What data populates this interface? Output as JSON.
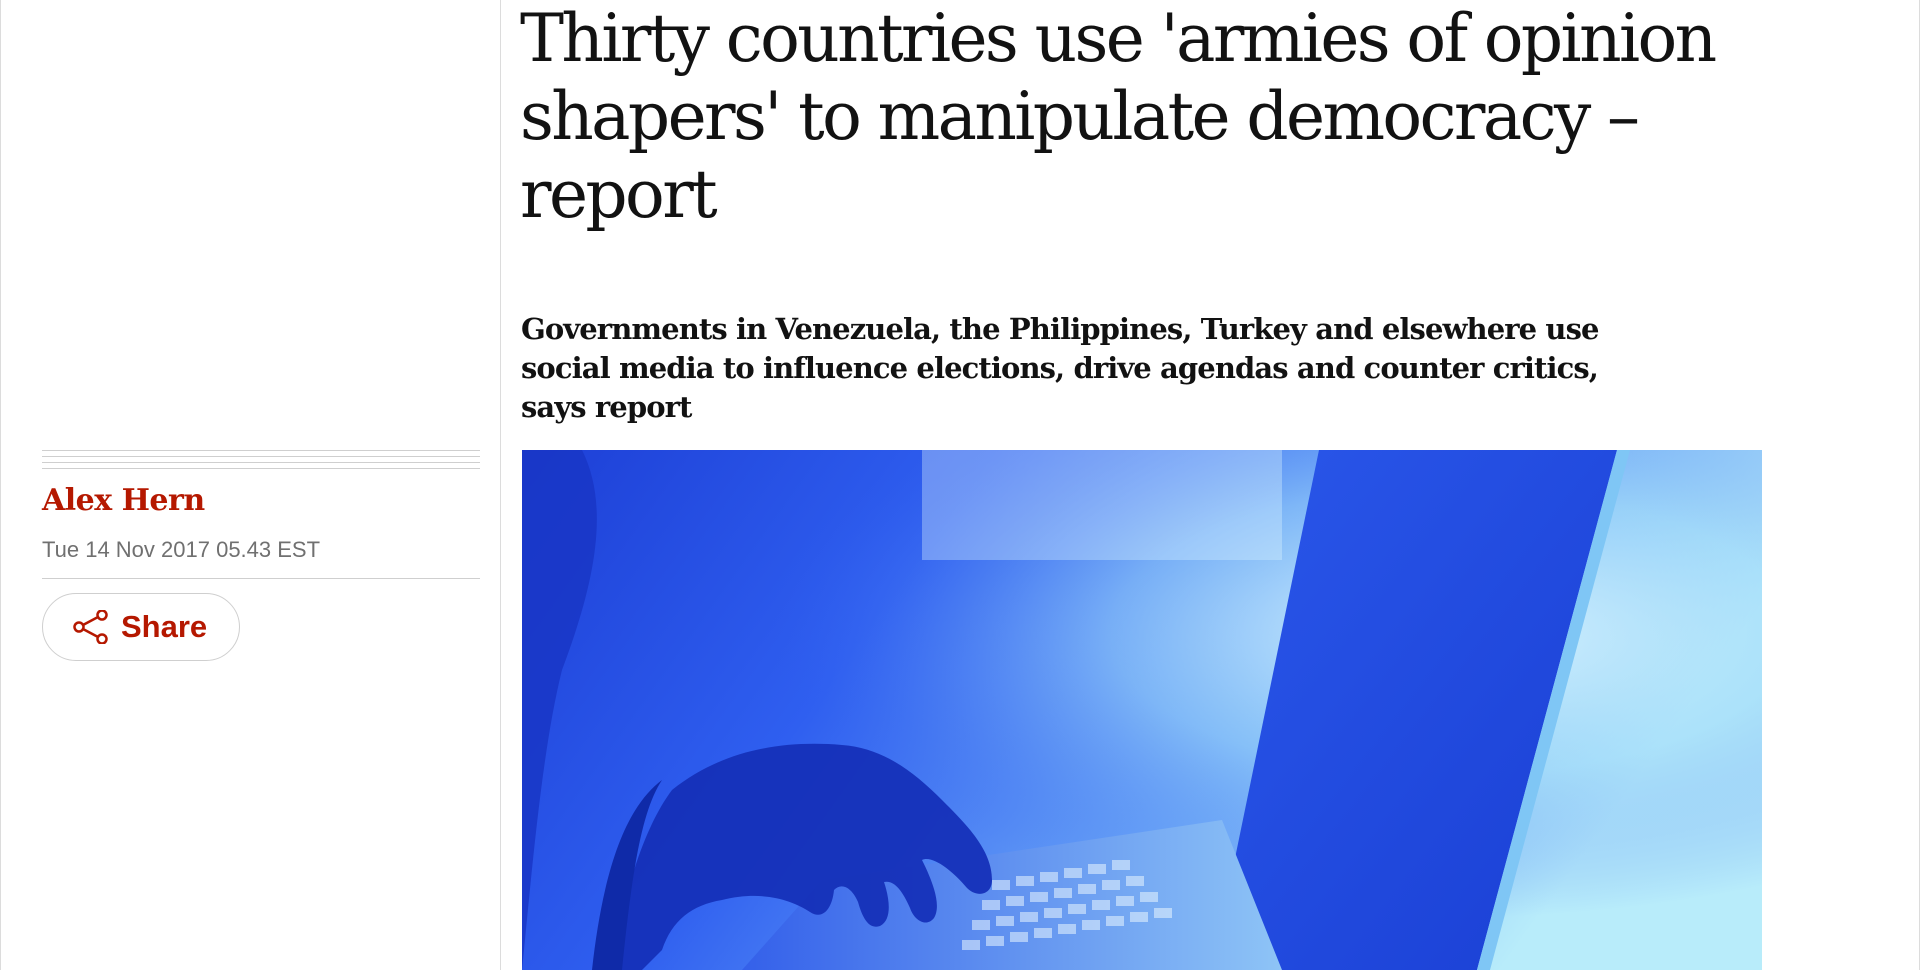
{
  "article": {
    "headline": "Thirty countries use 'armies of opinion shapers' to manipulate democracy – report",
    "standfirst": "Governments in Venezuela, the Philippines, Turkey and elsewhere use social media to influence elections, drive agendas and counter critics, says report",
    "byline": "Alex Hern",
    "date": "Tue 14 Nov 2017 05.43 EST"
  },
  "share": {
    "label": "Share",
    "icon": "share-icon"
  },
  "hero_image": {
    "subject": "hand typing on laptop keyboard in blue light"
  },
  "colors": {
    "accent": "#b51800",
    "text": "#121212",
    "meta": "#707070",
    "rule": "#cfcfcf"
  }
}
